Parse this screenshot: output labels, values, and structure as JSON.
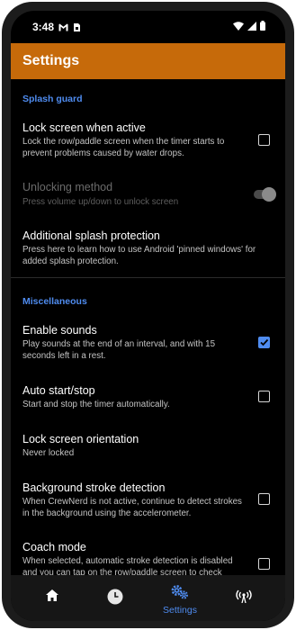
{
  "status": {
    "time": "3:48"
  },
  "appbar": {
    "title": "Settings"
  },
  "sections": {
    "splash_guard": "Splash guard",
    "miscellaneous": "Miscellaneous"
  },
  "prefs": {
    "lock_screen": {
      "title": "Lock screen when active",
      "summary": "Lock the row/paddle screen when the timer starts to prevent problems caused by water drops.",
      "checked": false
    },
    "unlocking_method": {
      "title": "Unlocking method",
      "summary": "Press volume up/down to unlock screen",
      "enabled": false
    },
    "splash_protection": {
      "title": "Additional splash protection",
      "summary": "Press here to learn how to use Android 'pinned windows' for added splash protection."
    },
    "enable_sounds": {
      "title": "Enable sounds",
      "summary": "Play sounds at the end of an interval, and with 15 seconds left in a rest.",
      "checked": true
    },
    "auto_start": {
      "title": "Auto start/stop",
      "summary": "Start and stop the timer automatically.",
      "checked": false
    },
    "orientation": {
      "title": "Lock screen orientation",
      "summary": "Never locked"
    },
    "background_stroke": {
      "title": "Background stroke detection",
      "summary": "When CrewNerd is not active, continue to detect strokes in the background using the accelerometer.",
      "checked": false
    },
    "coach_mode": {
      "title": "Coach mode",
      "summary": "When selected, automatic stroke detection is disabled and you can tap on the row/paddle screen to check stroke rates.",
      "checked": false
    }
  },
  "nav": {
    "settings_label": "Settings",
    "icons": [
      "home-icon",
      "clock-icon",
      "gears-icon",
      "antenna-icon"
    ],
    "active": "settings"
  },
  "colors": {
    "accent": "#4f8cf0",
    "appbar": "#c66a0a",
    "background": "#000000"
  }
}
